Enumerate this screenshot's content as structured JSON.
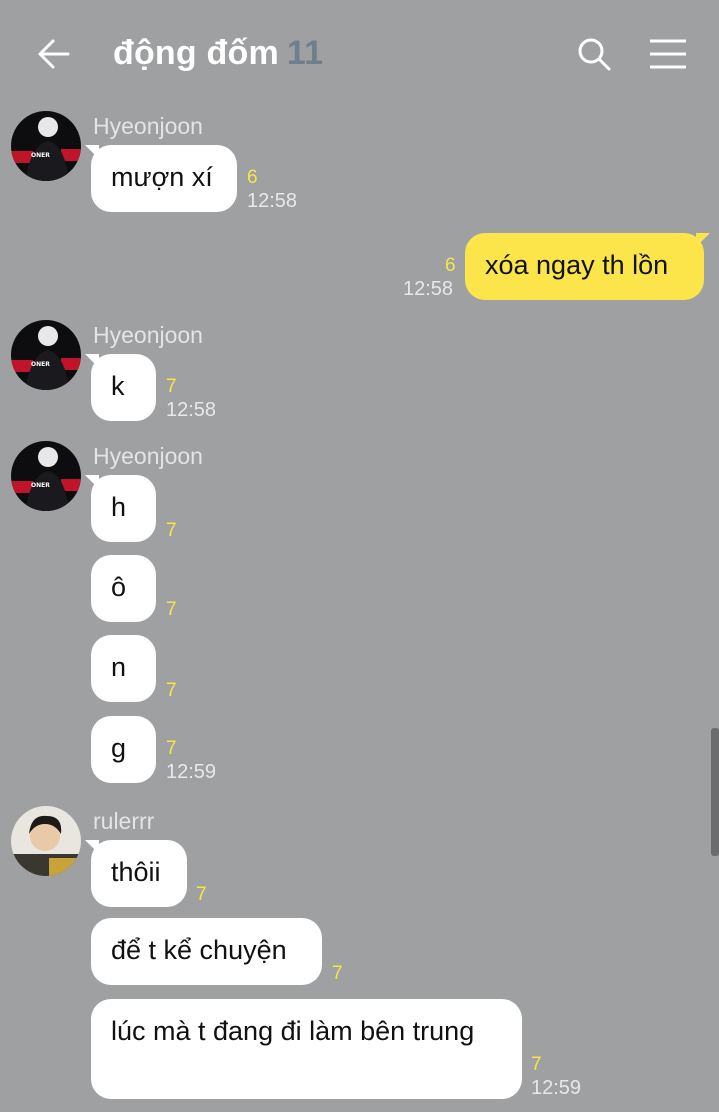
{
  "header": {
    "title": "động đốm",
    "member_count": "11",
    "icons": [
      "back-arrow-icon",
      "search-icon",
      "menu-icon"
    ]
  },
  "colors": {
    "background": "#9ea0a2",
    "my_bubble": "#fbe54a",
    "other_bubble": "#ffffff",
    "unread": "#f7e54a"
  },
  "messages": [
    {
      "sender": "Hyeonjoon",
      "text": "mượn xí",
      "unread": "6",
      "time": "12:58"
    },
    {
      "sender": "me",
      "text": "xóa ngay th lồn",
      "unread": "6",
      "time": "12:58"
    },
    {
      "sender": "Hyeonjoon",
      "text": "k",
      "unread": "7",
      "time": "12:58"
    },
    {
      "sender": "Hyeonjoon",
      "text": "h",
      "unread": "7",
      "time": ""
    },
    {
      "sender": "Hyeonjoon",
      "text": "ô",
      "unread": "7",
      "time": ""
    },
    {
      "sender": "Hyeonjoon",
      "text": "n",
      "unread": "7",
      "time": ""
    },
    {
      "sender": "Hyeonjoon",
      "text": "g",
      "unread": "7",
      "time": "12:59"
    },
    {
      "sender": "rulerrr",
      "text": "thôii",
      "unread": "7",
      "time": ""
    },
    {
      "sender": "rulerrr",
      "text": "để t kể chuyện",
      "unread": "7",
      "time": ""
    },
    {
      "sender": "rulerrr",
      "text": "lúc mà t đang đi làm bên trung",
      "unread": "7",
      "time": "12:59"
    }
  ],
  "senders": {
    "hyeonjoon": "Hyeonjoon",
    "rulerrr": "rulerrr"
  }
}
